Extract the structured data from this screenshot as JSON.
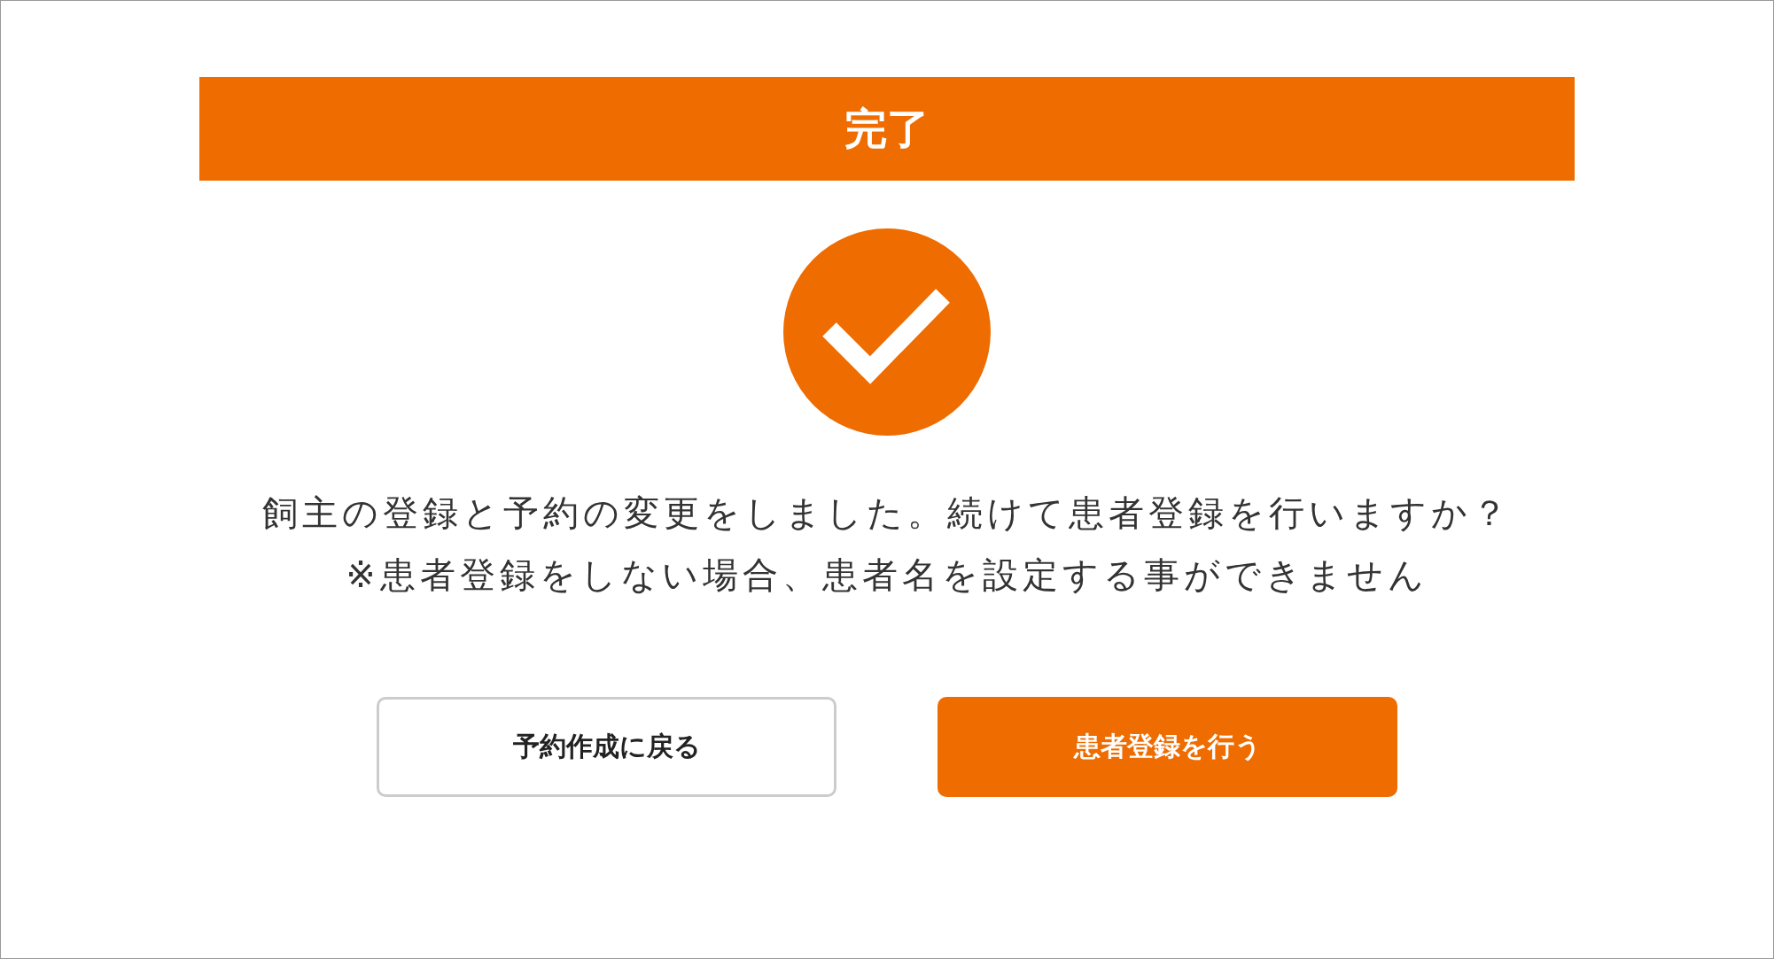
{
  "header": {
    "title": "完了"
  },
  "message": [
    "飼主の登録と予約の変更をしました。続けて患者登録を行いますか？",
    "※患者登録をしない場合、患者名を設定する事ができません"
  ],
  "buttons": [
    {
      "label": "予約作成に戻る",
      "kind": "secondary"
    },
    {
      "label": "患者登録を行う",
      "kind": "primary"
    }
  ]
}
